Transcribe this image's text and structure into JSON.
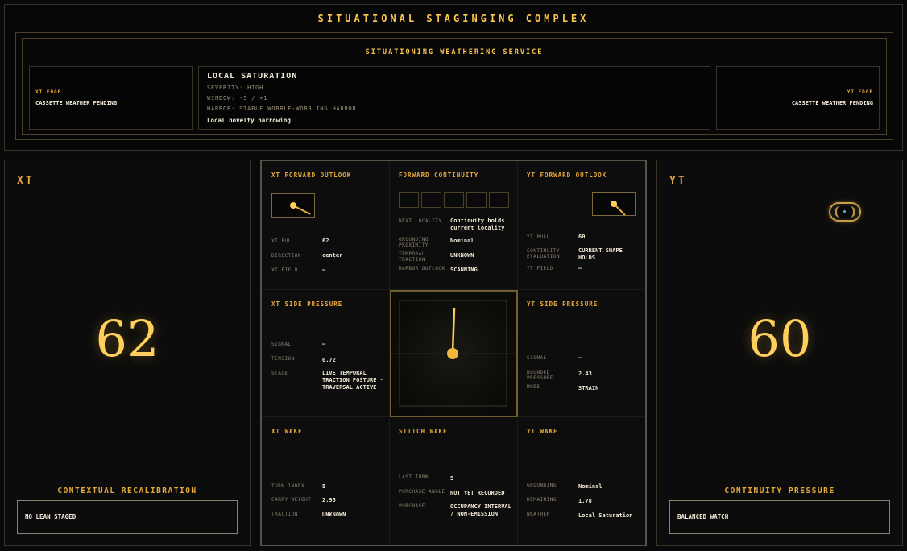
{
  "banner": {
    "title": "SITUATIONAL STAGINGING COMPLEX",
    "service_title": "SITUATIONING WEATHERING SERVICE",
    "xt_edge": {
      "label": "XT EDGE",
      "value": "CASSETTE WEATHER PENDING"
    },
    "yt_edge": {
      "label": "YT EDGE",
      "value": "CASSETTE WEATHER PENDING"
    },
    "local": {
      "title": "LOCAL SATURATION",
      "severity": "SEVERITY: HIGH",
      "window": "WINDOW: -5 / +1",
      "harbor": "HARBOR: STABLE WOBBLE-WOBBLING HARBOR",
      "note": "Local novelty narrowing"
    }
  },
  "left_panel": {
    "tag": "XT",
    "value": "62",
    "subtitle": "CONTEXTUAL RECALIBRATION",
    "box": "NO LEAN STAGED"
  },
  "right_panel": {
    "tag": "YT",
    "value": "60",
    "subtitle": "CONTINUITY PRESSURE",
    "box": "BALANCED WATCH",
    "toggle_icon": "capsule-toggle-icon"
  },
  "grid": {
    "xt_forward": {
      "title": "XT FORWARD OUTLOOK",
      "rows": [
        {
          "label": "XT PULL",
          "value": "62"
        },
        {
          "label": "DIRECTION",
          "value": "center"
        },
        {
          "label": "XT FIELD",
          "value": "—"
        }
      ]
    },
    "forward_continuity": {
      "title": "FORWARD CONTINUITY",
      "rows": [
        {
          "label": "NEXT LOCALITY",
          "value": "Continuity holds current locality"
        },
        {
          "label": "GROUNDING PROXIMITY",
          "value": "Nominal"
        },
        {
          "label": "TEMPORAL TRACTION",
          "value": "UNKNOWN"
        },
        {
          "label": "HARBOR OUTLOOK",
          "value": "SCANNING"
        }
      ]
    },
    "yt_forward": {
      "title": "YT FORWARD OUTLOOK",
      "rows": [
        {
          "label": "YT PULL",
          "value": "60"
        },
        {
          "label": "CONTINUITY EVALUATION",
          "value": "CURRENT SHAPE HOLDS"
        },
        {
          "label": "YT FIELD",
          "value": "—"
        }
      ]
    },
    "xt_side": {
      "title": "XT SIDE PRESSURE",
      "rows": [
        {
          "label": "SIGNAL",
          "value": "—"
        },
        {
          "label": "TENSION",
          "value": "0.72"
        },
        {
          "label": "STAGE",
          "value": "LIVE TEMPORAL TRACTION POSTURE · TRAVERSAL ACTIVE"
        }
      ]
    },
    "yt_side": {
      "title": "YT SIDE PRESSURE",
      "rows": [
        {
          "label": "SIGNAL",
          "value": "—"
        },
        {
          "label": "BOUNDED PRESSURE",
          "value": "2.43"
        },
        {
          "label": "MODE",
          "value": "STRAIN"
        }
      ]
    },
    "xt_wake": {
      "title": "XT WAKE",
      "rows": [
        {
          "label": "TURN INDEX",
          "value": "5"
        },
        {
          "label": "CARRY WEIGHT",
          "value": "2.95"
        },
        {
          "label": "TRACTION",
          "value": "UNKNOWN"
        }
      ]
    },
    "stitch_wake": {
      "title": "STITCH WAKE",
      "rows": [
        {
          "label": "LAST TURN",
          "value": "5"
        },
        {
          "label": "PURCHASE ANGLE",
          "value": "NOT YET RECORDED"
        },
        {
          "label": "PURCHASE",
          "value": "OCCUPANCY INTERVAL / NON-EMISSION"
        }
      ]
    },
    "yt_wake": {
      "title": "YT WAKE",
      "rows": [
        {
          "label": "GROUNDING",
          "value": "Nominal"
        },
        {
          "label": "REMAINING",
          "value": "1.78"
        },
        {
          "label": "WEATHER",
          "value": "Local Saturation"
        }
      ]
    }
  },
  "colors": {
    "accent": "#e6a93c",
    "bright": "#ffcf5c",
    "background": "#0a0a0a"
  }
}
